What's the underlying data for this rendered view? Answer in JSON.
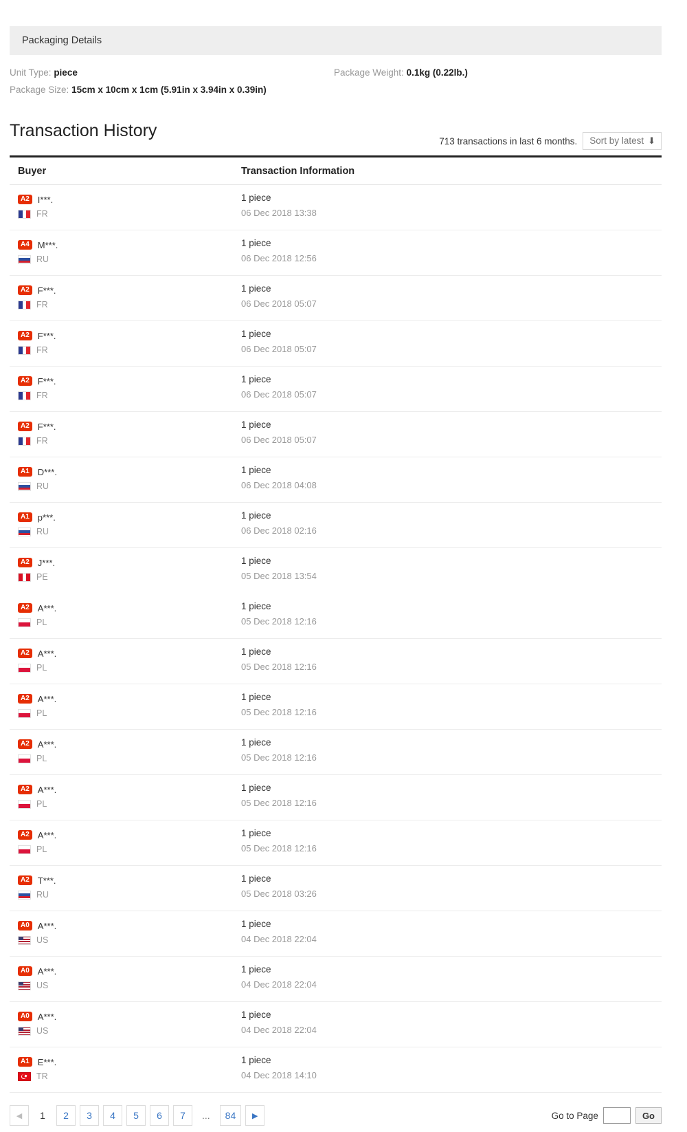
{
  "packaging": {
    "section_title": "Packaging Details",
    "unit_type_label": "Unit Type:",
    "unit_type_value": "piece",
    "package_weight_label": "Package Weight:",
    "package_weight_value": "0.1kg (0.22lb.)",
    "package_size_label": "Package Size:",
    "package_size_value": "15cm x 10cm x 1cm (5.91in x 3.94in x 0.39in)"
  },
  "transaction_history": {
    "title": "Transaction History",
    "count_text": "713 transactions in last 6 months.",
    "sort_label": "Sort by latest",
    "sort_icon": "arrow-down-icon",
    "columns": {
      "buyer": "Buyer",
      "info": "Transaction Information"
    },
    "rows": [
      {
        "level": "A2",
        "name": "I***.",
        "country": "FR",
        "qty": "1 piece",
        "date": "06 Dec 2018 13:38"
      },
      {
        "level": "A4",
        "name": "M***.",
        "country": "RU",
        "qty": "1 piece",
        "date": "06 Dec 2018 12:56"
      },
      {
        "level": "A2",
        "name": "F***.",
        "country": "FR",
        "qty": "1 piece",
        "date": "06 Dec 2018 05:07"
      },
      {
        "level": "A2",
        "name": "F***.",
        "country": "FR",
        "qty": "1 piece",
        "date": "06 Dec 2018 05:07"
      },
      {
        "level": "A2",
        "name": "F***.",
        "country": "FR",
        "qty": "1 piece",
        "date": "06 Dec 2018 05:07"
      },
      {
        "level": "A2",
        "name": "F***.",
        "country": "FR",
        "qty": "1 piece",
        "date": "06 Dec 2018 05:07"
      },
      {
        "level": "A1",
        "name": "D***.",
        "country": "RU",
        "qty": "1 piece",
        "date": "06 Dec 2018 04:08"
      },
      {
        "level": "A1",
        "name": "p***.",
        "country": "RU",
        "qty": "1 piece",
        "date": "06 Dec 2018 02:16"
      },
      {
        "level": "A2",
        "name": "J***.",
        "country": "PE",
        "qty": "1 piece",
        "date": "05 Dec 2018 13:54"
      },
      {
        "level": "A2",
        "name": "A***.",
        "country": "PL",
        "qty": "1 piece",
        "date": "05 Dec 2018 12:16"
      },
      {
        "level": "A2",
        "name": "A***.",
        "country": "PL",
        "qty": "1 piece",
        "date": "05 Dec 2018 12:16"
      },
      {
        "level": "A2",
        "name": "A***.",
        "country": "PL",
        "qty": "1 piece",
        "date": "05 Dec 2018 12:16"
      },
      {
        "level": "A2",
        "name": "A***.",
        "country": "PL",
        "qty": "1 piece",
        "date": "05 Dec 2018 12:16"
      },
      {
        "level": "A2",
        "name": "A***.",
        "country": "PL",
        "qty": "1 piece",
        "date": "05 Dec 2018 12:16"
      },
      {
        "level": "A2",
        "name": "A***.",
        "country": "PL",
        "qty": "1 piece",
        "date": "05 Dec 2018 12:16"
      },
      {
        "level": "A2",
        "name": "T***.",
        "country": "RU",
        "qty": "1 piece",
        "date": "05 Dec 2018 03:26"
      },
      {
        "level": "A0",
        "name": "A***.",
        "country": "US",
        "qty": "1 piece",
        "date": "04 Dec 2018 22:04"
      },
      {
        "level": "A0",
        "name": "A***.",
        "country": "US",
        "qty": "1 piece",
        "date": "04 Dec 2018 22:04"
      },
      {
        "level": "A0",
        "name": "A***.",
        "country": "US",
        "qty": "1 piece",
        "date": "04 Dec 2018 22:04"
      },
      {
        "level": "A1",
        "name": "E***.",
        "country": "TR",
        "qty": "1 piece",
        "date": "04 Dec 2018 14:10"
      }
    ]
  },
  "pagination": {
    "prev_icon": "chevron-left-icon",
    "next_icon": "chevron-right-icon",
    "pages": [
      "1",
      "2",
      "3",
      "4",
      "5",
      "6",
      "7",
      "...",
      "84"
    ],
    "current_page": "1",
    "goto_label": "Go to Page",
    "goto_value": "",
    "goto_placeholder": "",
    "go_button_label": "Go"
  },
  "colors": {
    "badge_red": "#e62e04",
    "link_blue": "#3a76c4",
    "muted": "#999999"
  }
}
